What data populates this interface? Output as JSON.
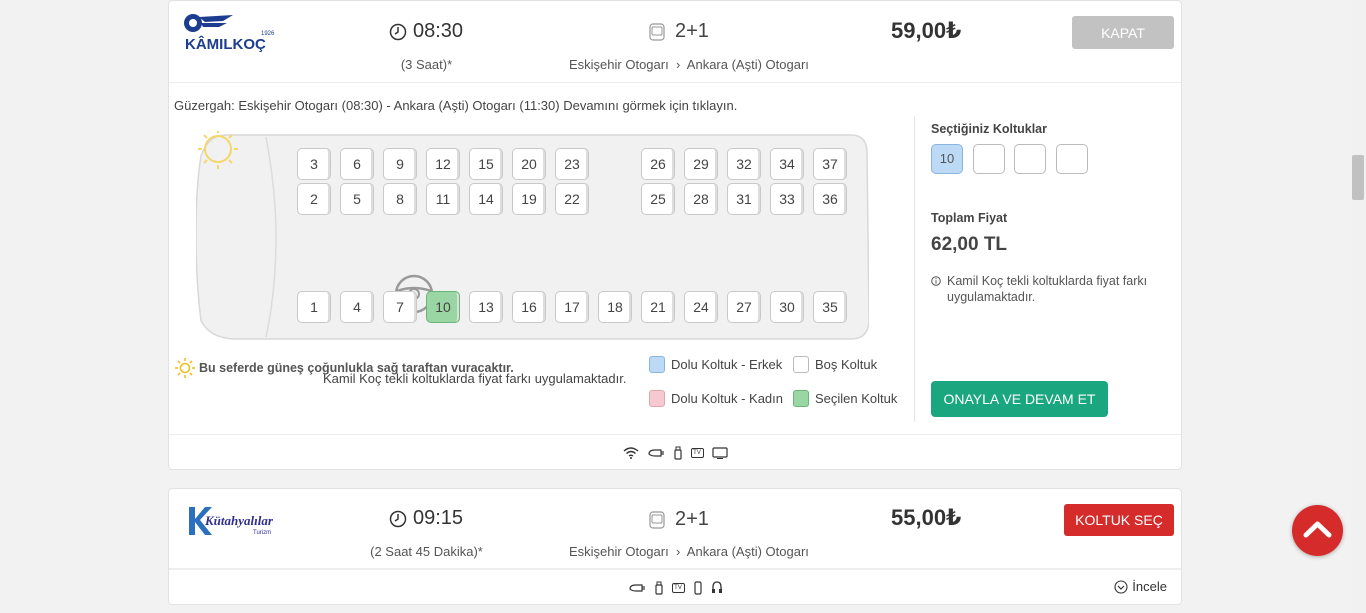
{
  "trip1": {
    "company": "Kâmil Koç",
    "logo_text": "KÂMILKOÇ",
    "logo_year": "1926",
    "time": "08:30",
    "duration": "(3 Saat)*",
    "seat_layout": "2+1",
    "route_from": "Eskişehir Otogarı",
    "route_sep": "›",
    "route_to": "Ankara (Aşti) Otogarı",
    "price": "59,00₺",
    "close_label": "KAPAT",
    "route_note": "Güzergah: Eskişehir Otogarı (08:30) - Ankara (Aşti) Otogarı (11:30) Devamını görmek için tıklayın.",
    "seats_top_row": [
      "3",
      "6",
      "9",
      "12",
      "15",
      "20",
      "23",
      "26",
      "29",
      "32",
      "34",
      "37"
    ],
    "seats_second_row": [
      "2",
      "5",
      "8",
      "11",
      "14",
      "19",
      "22",
      "25",
      "28",
      "31",
      "33",
      "36"
    ],
    "seats_bottom_row": [
      "1",
      "4",
      "7",
      "10",
      "13",
      "16",
      "17",
      "18",
      "21",
      "24",
      "27",
      "30",
      "35"
    ],
    "selected_seat": "10",
    "bus_note": "Kamil Koç tekli koltuklarda fiyat farkı uygulamaktadır.",
    "sun_note": "Bu seferde güneş çoğunlukla sağ taraftan vuracaktır.",
    "legend": {
      "male": "Dolu Koltuk - Erkek",
      "empty": "Boş Koltuk",
      "female": "Dolu Koltuk - Kadın",
      "selected": "Seçilen Koltuk"
    },
    "legend_colors": {
      "male": "#bcd9f5",
      "empty": "#ffffff",
      "female": "#f5c9cf",
      "selected": "#9ad6a4"
    },
    "selected_title": "Seçtiğiniz Koltuklar",
    "selected_list": [
      "10",
      "",
      "",
      ""
    ],
    "total_label": "Toplam Fiyat",
    "total_value": "62,00 TL",
    "info_note": "Kamil Koç tekli koltuklarda fiyat farkı uygulamaktadır.",
    "confirm_label": "ONAYLA VE DEVAM ET",
    "features": [
      "wifi-icon",
      "outlet-icon",
      "usb-icon",
      "tv-icon",
      "screen-icon"
    ]
  },
  "trip2": {
    "company": "Kütahyalılar Turizm",
    "logo_text": "Kütahyalılar",
    "logo_sub": "Turizm",
    "time": "09:15",
    "duration": "(2 Saat 45 Dakika)*",
    "seat_layout": "2+1",
    "route_from": "Eskişehir Otogarı",
    "route_sep": "›",
    "route_to": "Ankara (Aşti) Otogarı",
    "price": "55,00₺",
    "select_label": "KOLTUK SEÇ",
    "inspect_label": "İncele",
    "features": [
      "outlet-icon",
      "usb-icon",
      "tv-icon",
      "phone-icon",
      "headphone-icon"
    ]
  },
  "tv_text": "TV",
  "accent_red": "#d62b2b",
  "accent_green": "#1aa77f"
}
